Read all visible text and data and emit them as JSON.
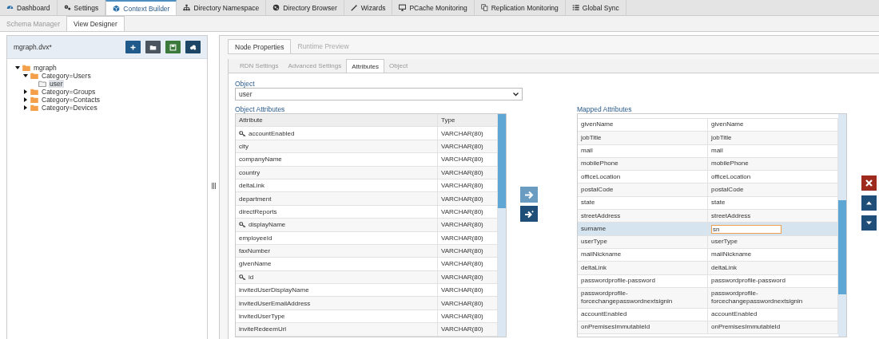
{
  "nav": [
    {
      "label": "Dashboard",
      "kind": "gauge",
      "selected": false
    },
    {
      "label": "Settings",
      "kind": "gears",
      "selected": false
    },
    {
      "label": "Context Builder",
      "kind": "cube",
      "selected": true
    },
    {
      "label": "Directory Namespace",
      "kind": "sitemap",
      "selected": false
    },
    {
      "label": "Directory Browser",
      "kind": "globe",
      "selected": false
    },
    {
      "label": "Wizards",
      "kind": "wand",
      "selected": false
    },
    {
      "label": "PCache Monitoring",
      "kind": "monitor",
      "selected": false
    },
    {
      "label": "Replication Monitoring",
      "kind": "copy",
      "selected": false
    },
    {
      "label": "Global Sync",
      "kind": "list",
      "selected": false
    }
  ],
  "subtabs": [
    {
      "label": "Schema Manager",
      "selected": false
    },
    {
      "label": "View Designer",
      "selected": true
    }
  ],
  "designer": {
    "file": "mgraph.dvx*",
    "toolbar": [
      {
        "kind": "add",
        "color": "#1f5a8a"
      },
      {
        "kind": "open",
        "color": "#4a5560"
      },
      {
        "kind": "save",
        "color": "#3b7a3b"
      },
      {
        "kind": "cloud",
        "color": "#1d4566"
      }
    ],
    "tree": [
      {
        "label": "mgraph",
        "kind": "folder",
        "expanded": true,
        "selected": false,
        "children": [
          {
            "label": "Category=Users",
            "kind": "folder",
            "expanded": true,
            "selected": false,
            "children": [
              {
                "label": "user",
                "kind": "entry",
                "selected": true
              }
            ]
          },
          {
            "label": "Category=Groups",
            "kind": "folder",
            "expanded": false,
            "selected": false
          },
          {
            "label": "Category=Contacts",
            "kind": "folder",
            "expanded": false,
            "selected": false
          },
          {
            "label": "Category=Devices",
            "kind": "folder",
            "expanded": false,
            "selected": false
          }
        ]
      }
    ]
  },
  "panel_tabs": [
    {
      "label": "Node Properties",
      "selected": true
    },
    {
      "label": "Runtime Preview",
      "selected": false
    }
  ],
  "inner_tabs": [
    {
      "label": "RDN Settings",
      "selected": false
    },
    {
      "label": "Advanced Settings",
      "selected": false
    },
    {
      "label": "Attributes",
      "selected": true
    },
    {
      "label": "Object",
      "selected": false
    }
  ],
  "object": {
    "label": "Object",
    "value": "user"
  },
  "object_attributes": {
    "title": "Object Attributes",
    "columns": [
      "Attribute",
      "Type"
    ],
    "rows": [
      {
        "name": "accountEnabled",
        "type": "VARCHAR(80)",
        "key": true
      },
      {
        "name": "city",
        "type": "VARCHAR(80)",
        "key": false
      },
      {
        "name": "companyName",
        "type": "VARCHAR(80)",
        "key": false
      },
      {
        "name": "country",
        "type": "VARCHAR(80)",
        "key": false
      },
      {
        "name": "deltaLink",
        "type": "VARCHAR(80)",
        "key": false
      },
      {
        "name": "department",
        "type": "VARCHAR(80)",
        "key": false
      },
      {
        "name": "directReports",
        "type": "VARCHAR(80)",
        "key": false
      },
      {
        "name": "displayName",
        "type": "VARCHAR(80)",
        "key": true
      },
      {
        "name": "employeeId",
        "type": "VARCHAR(80)",
        "key": false
      },
      {
        "name": "faxNumber",
        "type": "VARCHAR(80)",
        "key": false
      },
      {
        "name": "givenName",
        "type": "VARCHAR(80)",
        "key": false
      },
      {
        "name": "id",
        "type": "VARCHAR(80)",
        "key": true
      },
      {
        "name": "invitedUserDisplayName",
        "type": "VARCHAR(80)",
        "key": false
      },
      {
        "name": "invitedUserEmailAddress",
        "type": "VARCHAR(80)",
        "key": false
      },
      {
        "name": "invitedUserType",
        "type": "VARCHAR(80)",
        "key": false
      },
      {
        "name": "inviteRedeemUrl",
        "type": "VARCHAR(80)",
        "key": false
      }
    ]
  },
  "transfer_buttons": [
    {
      "kind": "map",
      "disabled": true
    },
    {
      "kind": "map_all",
      "disabled": false
    }
  ],
  "mapped_attributes": {
    "title": "Mapped Attributes",
    "rows": [
      {
        "source": "givenName",
        "target": "givenName",
        "selected": false
      },
      {
        "source": "jobTitle",
        "target": "jobTitle",
        "selected": false
      },
      {
        "source": "mail",
        "target": "mail",
        "selected": false
      },
      {
        "source": "mobilePhone",
        "target": "mobilePhone",
        "selected": false
      },
      {
        "source": "officeLocation",
        "target": "officeLocation",
        "selected": false
      },
      {
        "source": "postalCode",
        "target": "postalCode",
        "selected": false
      },
      {
        "source": "state",
        "target": "state",
        "selected": false
      },
      {
        "source": "streetAddress",
        "target": "streetAddress",
        "selected": false
      },
      {
        "source": "surname",
        "target": "sn",
        "selected": true
      },
      {
        "source": "userType",
        "target": "userType",
        "selected": false
      },
      {
        "source": "mailNickname",
        "target": "mailNickname",
        "selected": false
      },
      {
        "source": "deltaLink",
        "target": "deltaLink",
        "selected": false
      },
      {
        "source": "passwordprofile-password",
        "target": "passwordprofile-password",
        "selected": false
      },
      {
        "source": "passwordprofile-forcechangepasswordnextsignin",
        "target": "passwordprofile-forcechangepasswordnextsignin",
        "selected": false
      },
      {
        "source": "accountEnabled",
        "target": "accountEnabled",
        "selected": false
      },
      {
        "source": "onPremisesImmutableId",
        "target": "onPremisesImmutableId",
        "selected": false
      }
    ]
  },
  "row_buttons": [
    {
      "kind": "remove"
    },
    {
      "kind": "up"
    },
    {
      "kind": "down"
    }
  ]
}
